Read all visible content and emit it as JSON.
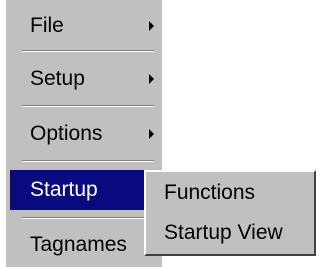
{
  "menu": {
    "items": [
      {
        "label": "File",
        "has_submenu": true
      },
      {
        "label": "Setup",
        "has_submenu": true
      },
      {
        "label": "Options",
        "has_submenu": true
      },
      {
        "label": "Startup",
        "has_submenu": true,
        "selected": true
      },
      {
        "label": "Tagnames",
        "has_submenu": false
      }
    ]
  },
  "submenu": {
    "items": [
      {
        "label": "Functions"
      },
      {
        "label": "Startup View"
      }
    ]
  },
  "colors": {
    "menu_bg": "#c0c0c0",
    "selected_bg": "#0a0a80",
    "selected_text": "#ffffff"
  },
  "icons": {
    "submenu_arrow": "chevron-right-icon"
  }
}
